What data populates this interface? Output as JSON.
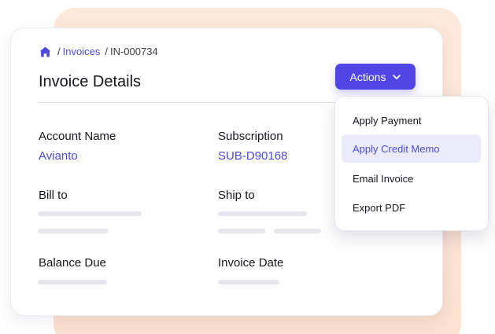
{
  "breadcrumb": {
    "sep1": "/",
    "invoices_link": "Invoices",
    "sep2": "/",
    "current": "IN-000734"
  },
  "header": {
    "title": "Invoice Details",
    "actions_label": "Actions"
  },
  "fields": {
    "account_name": {
      "label": "Account Name",
      "value": "Avianto"
    },
    "subscription": {
      "label": "Subscription",
      "value": "SUB-D90168"
    },
    "bill_to": {
      "label": "Bill to"
    },
    "ship_to": {
      "label": "Ship to"
    },
    "balance_due": {
      "label": "Balance Due"
    },
    "invoice_date": {
      "label": "Invoice Date"
    }
  },
  "actions_menu": {
    "items": [
      {
        "label": "Apply Payment"
      },
      {
        "label": "Apply Credit Memo",
        "highlighted": true
      },
      {
        "label": "Email Invoice"
      },
      {
        "label": "Export PDF"
      }
    ]
  },
  "colors": {
    "accent": "#5046e5",
    "link": "#4b4bd8",
    "highlight_bg": "#ecebfb",
    "backdrop": "#fbe1d0"
  },
  "icons": {
    "home": "home-icon",
    "actions_chevron": "chevron-down-icon"
  }
}
